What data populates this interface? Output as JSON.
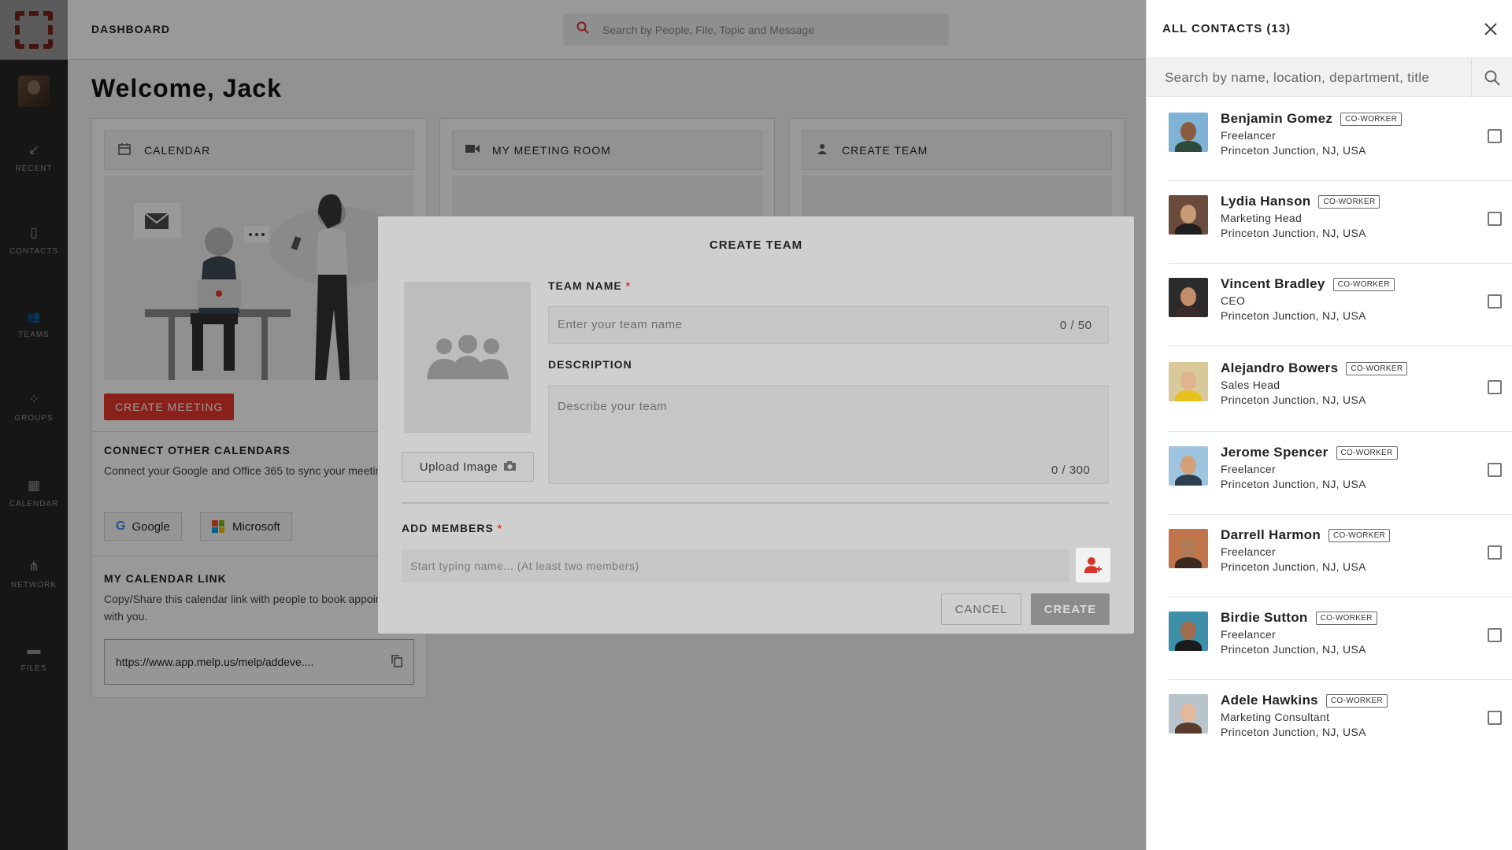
{
  "sidebar": {
    "items": [
      {
        "label": "RECENT",
        "icon": "↙"
      },
      {
        "label": "CONTACTS",
        "icon": "▯"
      },
      {
        "label": "TEAMS",
        "icon": "👥"
      },
      {
        "label": "GROUPS",
        "icon": "⁘"
      },
      {
        "label": "CALENDAR",
        "icon": "▦"
      },
      {
        "label": "NETWORK",
        "icon": "⋔"
      },
      {
        "label": "FILES",
        "icon": "▬"
      }
    ]
  },
  "header": {
    "title": "DASHBOARD",
    "search_placeholder": "Search by People, File, Topic and Message"
  },
  "main": {
    "welcome": "Welcome, Jack",
    "cards": {
      "calendar": {
        "title": "CALENDAR",
        "create_meeting": "CREATE MEETING",
        "connect_title": "CONNECT OTHER CALENDARS",
        "connect_text": "Connect your Google and Office 365 to sync your meetings.",
        "google": "Google",
        "microsoft": "Microsoft",
        "link_title": "MY CALENDAR LINK",
        "link_text": "Copy/Share this calendar link with people to book appointment with you.",
        "link_url": "https://www.app.melp.us/melp/addeve...."
      },
      "meeting_room": {
        "title": "MY MEETING ROOM"
      },
      "create_team": {
        "title": "CREATE TEAM"
      }
    }
  },
  "modal": {
    "title": "CREATE TEAM",
    "upload_label": "Upload Image",
    "team_name_label": "TEAM NAME",
    "team_name_placeholder": "Enter your team name",
    "team_name_counter": "0 / 50",
    "description_label": "DESCRIPTION",
    "description_placeholder": "Describe your team",
    "description_counter": "0 / 300",
    "members_label": "ADD MEMBERS",
    "members_placeholder": "Start typing name... (At least two members)",
    "required_mark": "*",
    "cancel": "CANCEL",
    "create": "CREATE"
  },
  "panel": {
    "title": "ALL CONTACTS (13)",
    "search_placeholder": "Search by name, location, department, title",
    "contacts": [
      {
        "name": "Benjamin Gomez",
        "badge": "CO-WORKER",
        "role": "Freelancer",
        "location": "Princeton Junction, NJ, USA",
        "bg": "#7fb3d5",
        "skin": "#8d5b3e",
        "shirt": "#2e4a3a"
      },
      {
        "name": "Lydia Hanson",
        "badge": "CO-WORKER",
        "role": "Marketing Head",
        "location": "Princeton Junction, NJ, USA",
        "bg": "#6a4a3a",
        "skin": "#c99a76",
        "shirt": "#1f1f1f"
      },
      {
        "name": "Vincent Bradley",
        "badge": "CO-WORKER",
        "role": "CEO",
        "location": "Princeton Junction, NJ, USA",
        "bg": "#2b2b2b",
        "skin": "#c48d6a",
        "shirt": "#3a2a2a"
      },
      {
        "name": "Alejandro Bowers",
        "badge": "CO-WORKER",
        "role": "Sales Head",
        "location": "Princeton Junction, NJ, USA",
        "bg": "#d9c99a",
        "skin": "#e0b48e",
        "shirt": "#e6c21c"
      },
      {
        "name": "Jerome Spencer",
        "badge": "CO-WORKER",
        "role": "Freelancer",
        "location": "Princeton Junction, NJ, USA",
        "bg": "#9fc4e0",
        "skin": "#d4a07a",
        "shirt": "#2c3e50"
      },
      {
        "name": "Darrell Harmon",
        "badge": "CO-WORKER",
        "role": "Freelancer",
        "location": "Princeton Junction, NJ, USA",
        "bg": "#c0744a",
        "skin": "#b07a55",
        "shirt": "#3b2a22"
      },
      {
        "name": "Birdie Sutton",
        "badge": "CO-WORKER",
        "role": "Freelancer",
        "location": "Princeton Junction, NJ, USA",
        "bg": "#3e8fa8",
        "skin": "#a06d4c",
        "shirt": "#1a1a1a"
      },
      {
        "name": "Adele Hawkins",
        "badge": "CO-WORKER",
        "role": "Marketing Consultant",
        "location": "Princeton Junction, NJ, USA",
        "bg": "#b8c4cc",
        "skin": "#e4b89a",
        "shirt": "#5a3a2a"
      }
    ]
  },
  "colors": {
    "accent_red": "#e5362b",
    "sidebar_bg": "#3f3f3f",
    "modal_bg": "#cfcfcf"
  }
}
